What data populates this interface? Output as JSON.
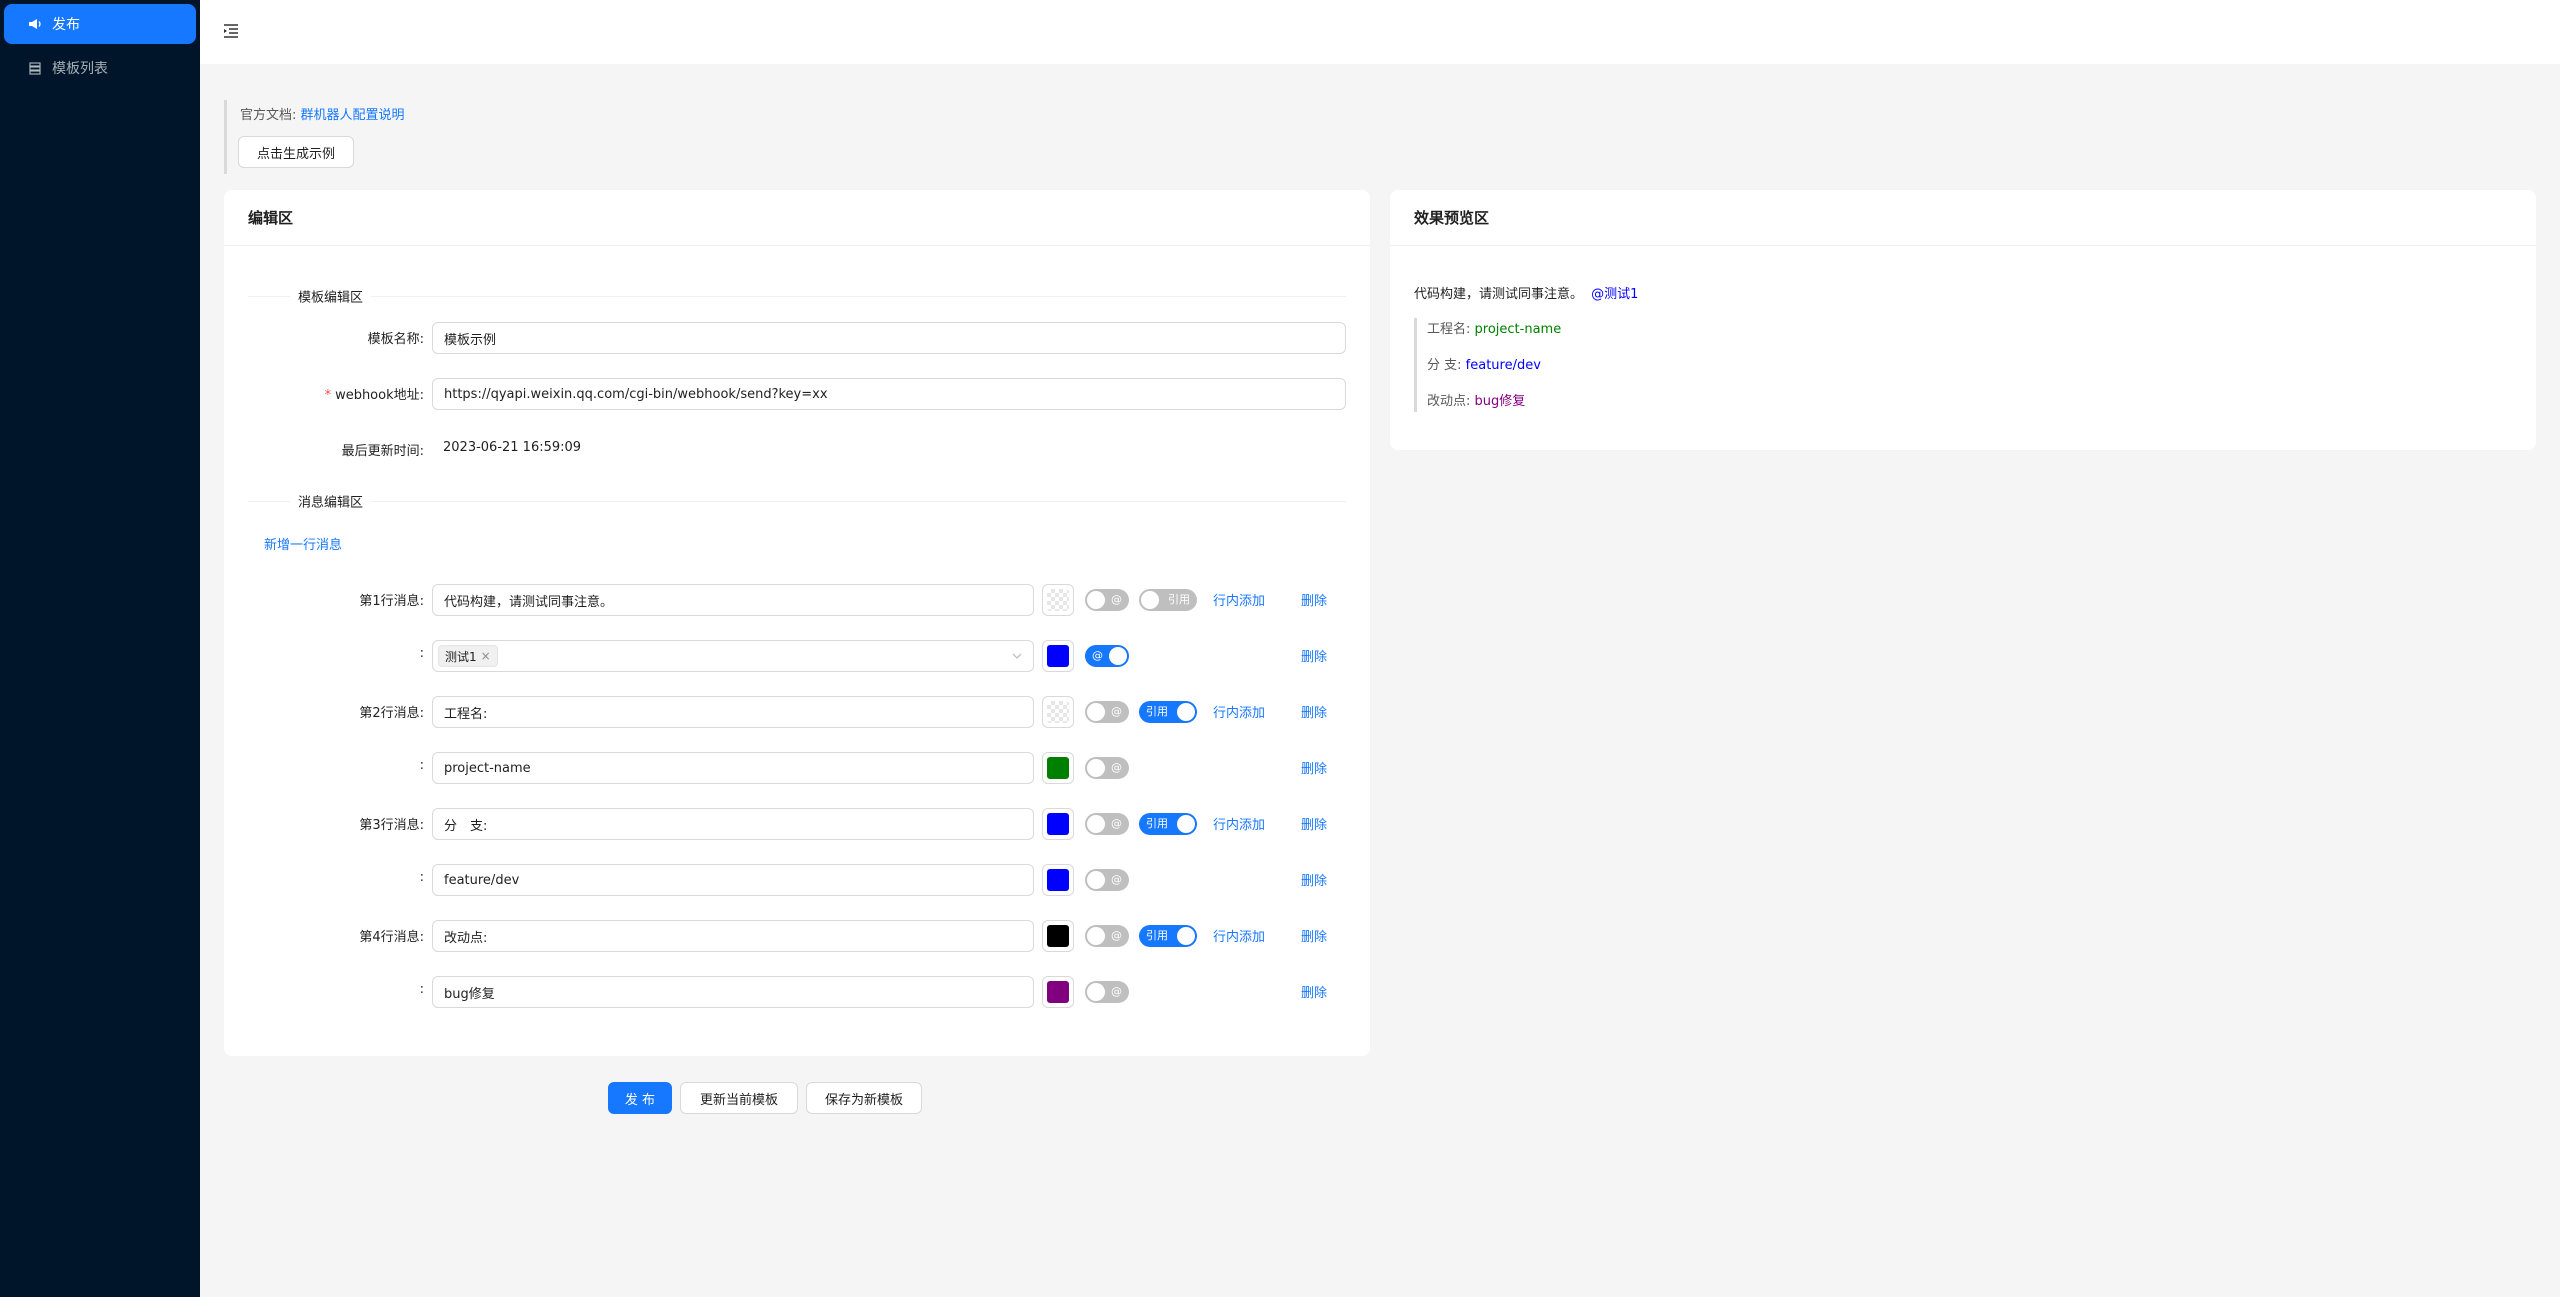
{
  "sidebar": {
    "items": [
      {
        "label": "发布",
        "icon": "megaphone-icon",
        "active": true
      },
      {
        "label": "模板列表",
        "icon": "list-icon",
        "active": false
      }
    ]
  },
  "doc": {
    "prefix": "官方文档:",
    "link_text": "群机器人配置说明",
    "generate_button": "点击生成示例"
  },
  "editor": {
    "title": "编辑区",
    "template_section": "模板编辑区",
    "template_name_label": "模板名称:",
    "template_name_value": "模板示例",
    "webhook_label": "webhook地址:",
    "webhook_value": "https://qyapi.weixin.qq.com/cgi-bin/webhook/send?key=xx",
    "updated_label": "最后更新时间:",
    "updated_value": "2023-06-21 16:59:09",
    "message_section": "消息编辑区",
    "add_line": "新增一行消息",
    "inline_add": "行内添加",
    "delete": "删除",
    "quote_switch": "引用",
    "mention_switch": "@",
    "rows": [
      {
        "label": "第1行消息:",
        "value": "代码构建，请测试同事注意。",
        "color": "",
        "mention_on": false,
        "quote_on": false
      },
      {
        "label": ":",
        "mention_tag": "测试1",
        "color": "#0000ff",
        "mention_on": true
      },
      {
        "label": "第2行消息:",
        "value": "工程名:",
        "color": "",
        "mention_on": false,
        "quote_on": true
      },
      {
        "label": ":",
        "value": "project-name",
        "color": "#008000",
        "mention_on": false
      },
      {
        "label": "第3行消息:",
        "value": "分　支:",
        "color": "#0000ff",
        "mention_on": false,
        "quote_on": true
      },
      {
        "label": ":",
        "value": "feature/dev",
        "color": "#0000ff",
        "mention_on": false
      },
      {
        "label": "第4行消息:",
        "value": "改动点:",
        "color": "#000000",
        "mention_on": false,
        "quote_on": true
      },
      {
        "label": ":",
        "value": "bug修复",
        "color": "#800080",
        "mention_on": false
      }
    ],
    "publish_button": "发 布",
    "update_button": "更新当前模板",
    "save_new_button": "保存为新模板"
  },
  "preview": {
    "title": "效果预览区",
    "first_line": "代码构建，请测试同事注意。",
    "mention": "@测试1",
    "mention_color": "#0000ff",
    "quotes": [
      {
        "key": "工程名:",
        "value": "project-name",
        "color": "#008000"
      },
      {
        "key": "分 支:",
        "value": "feature/dev",
        "color": "#0000ff"
      },
      {
        "key": "改动点:",
        "value": "bug修复",
        "color": "#800080"
      }
    ]
  }
}
